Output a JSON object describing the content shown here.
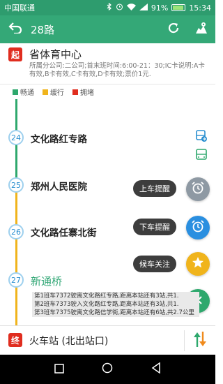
{
  "status_bar": {
    "carrier": "中国联通",
    "battery": "91%",
    "time": "15:34"
  },
  "header": {
    "title": "28路"
  },
  "start_station": {
    "badge": "起",
    "name": "省体育中心",
    "info": "所属分公司:二公司;首末班时间:6:00-21：30;IC卡说明:A卡有效,B卡有效,C卡有效,D卡有效;票价1元."
  },
  "legend": [
    {
      "label": "畅通",
      "color": "#2ea86d"
    },
    {
      "label": "缓行",
      "color": "#f0b41c"
    },
    {
      "label": "拥堵",
      "color": "#e02d1f"
    }
  ],
  "stops": [
    {
      "index": "24",
      "name": "文化路红专路"
    },
    {
      "index": "25",
      "name": "郑州人民医院"
    },
    {
      "index": "26",
      "name": "文化路任寨北街"
    },
    {
      "index": "27",
      "name": "新通桥"
    }
  ],
  "actions": {
    "board_reminder": "上车提醒",
    "alight_reminder": "下车提醒",
    "follow": "候车关注"
  },
  "buses": [
    "第1班车7372驶离文化路红专路,距离本站还有3站,共1.",
    "第2班车7373驶入文化路红专路,距离本站还有3站,共1.",
    "第3班车7375驶离文化路信学街,距离本站还有6站,共2.7公里"
  ],
  "end_station": {
    "badge": "终",
    "name": "火车站 (北出站口)"
  },
  "colors": {
    "status_bar": "#2e9c6e",
    "app_bar": "#34a877",
    "smooth": "#2ea86d",
    "slow": "#f0b41c",
    "jam": "#e02d1f"
  }
}
